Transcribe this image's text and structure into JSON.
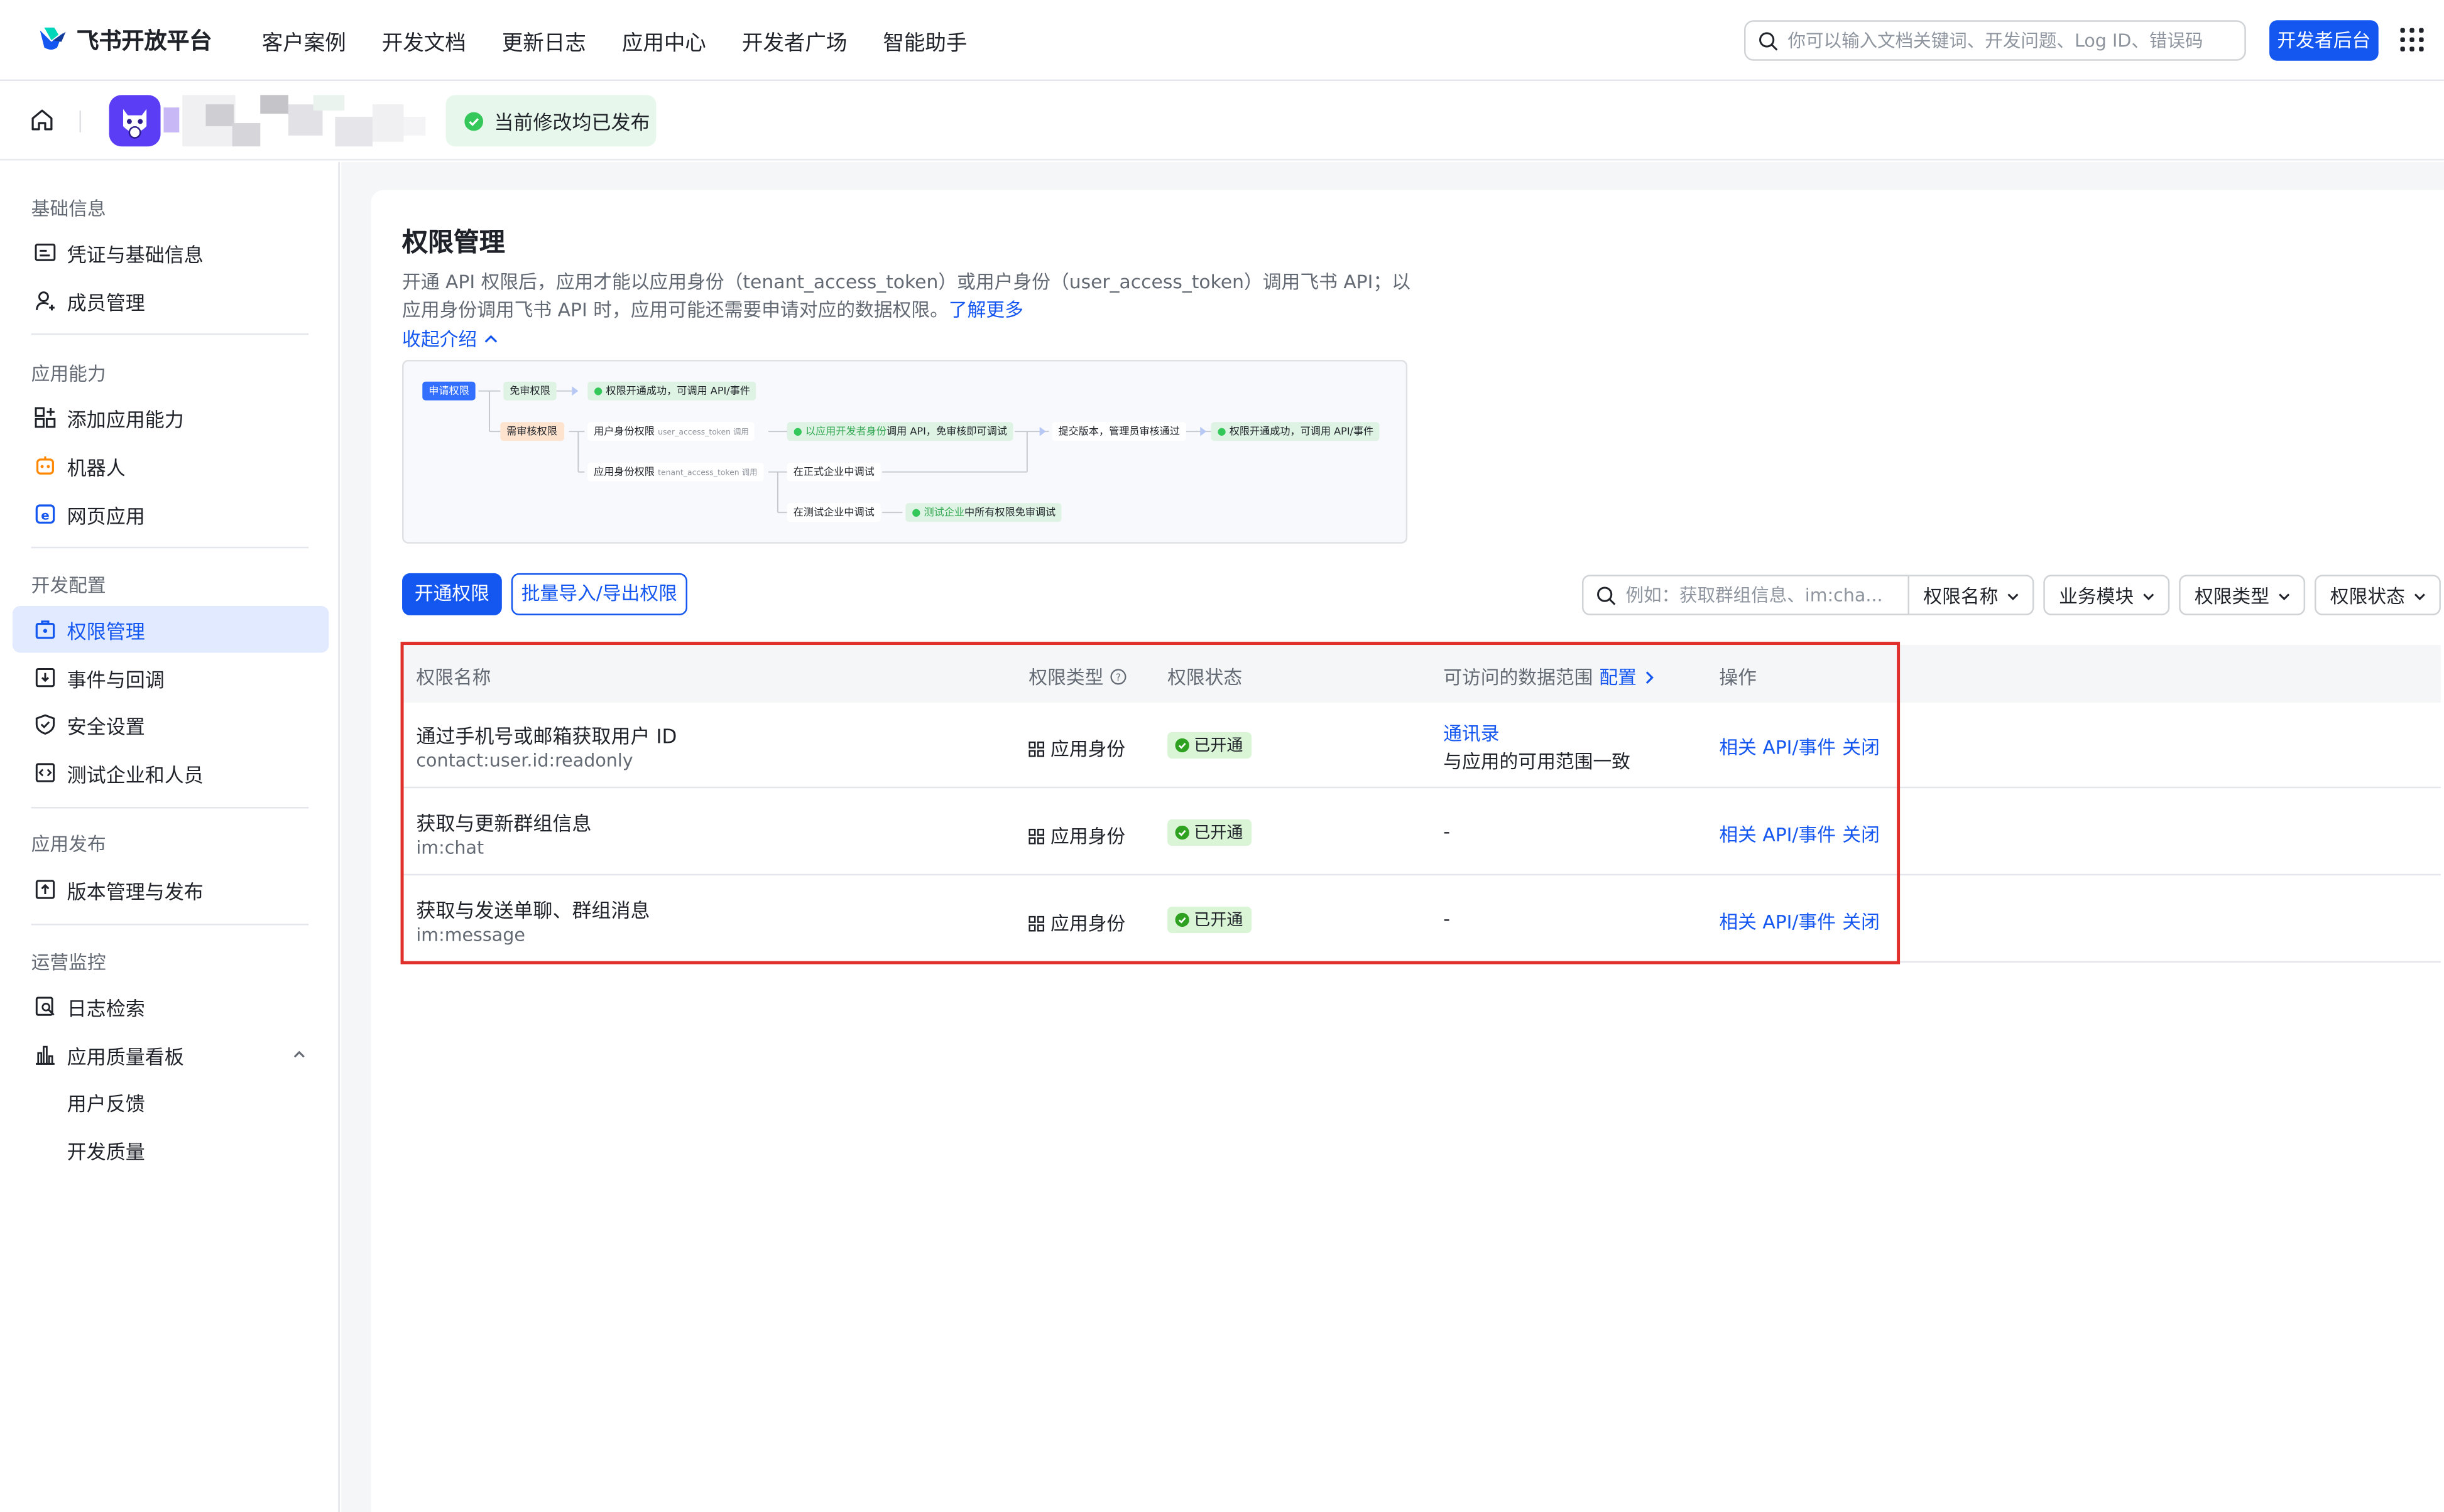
{
  "header": {
    "brand": "飞书开放平台",
    "nav": [
      "客户案例",
      "开发文档",
      "更新日志",
      "应用中心",
      "开发者广场",
      "智能助手"
    ],
    "search_placeholder": "你可以输入文档关键词、开发问题、Log ID、错误码",
    "dev_console_label": "开发者后台"
  },
  "appbar": {
    "publish_status": "当前修改均已发布"
  },
  "sidebar": {
    "sections": [
      {
        "title": "基础信息",
        "items": [
          {
            "label": "凭证与基础信息",
            "icon": "credential-icon"
          },
          {
            "label": "成员管理",
            "icon": "member-icon"
          }
        ]
      },
      {
        "title": "应用能力",
        "items": [
          {
            "label": "添加应用能力",
            "icon": "add-capability-icon"
          },
          {
            "label": "机器人",
            "icon": "robot-icon"
          },
          {
            "label": "网页应用",
            "icon": "web-app-icon"
          }
        ]
      },
      {
        "title": "开发配置",
        "items": [
          {
            "label": "权限管理",
            "icon": "permission-icon",
            "active": true
          },
          {
            "label": "事件与回调",
            "icon": "event-icon"
          },
          {
            "label": "安全设置",
            "icon": "shield-icon"
          },
          {
            "label": "测试企业和人员",
            "icon": "test-icon"
          }
        ]
      },
      {
        "title": "应用发布",
        "items": [
          {
            "label": "版本管理与发布",
            "icon": "version-icon"
          }
        ]
      },
      {
        "title": "运营监控",
        "items": [
          {
            "label": "日志检索",
            "icon": "log-search-icon"
          },
          {
            "label": "应用质量看板",
            "icon": "chart-icon"
          },
          {
            "label": "用户反馈",
            "icon": ""
          },
          {
            "label": "开发质量",
            "icon": ""
          }
        ]
      }
    ]
  },
  "main": {
    "title": "权限管理",
    "description": "开通 API 权限后，应用才能以应用身份（tenant_access_token）或用户身份（user_access_token）调用飞书 API；以应用身份调用飞书 API 时，应用可能还需要申请对应的数据权限。",
    "learn_more": "了解更多",
    "collapse_label": "收起介绍",
    "flow": {
      "apply": "申请权限",
      "no_review": "免审权限",
      "no_review_result": "权限开通成功，可调用 API/事件",
      "need_review": "需审核权限",
      "user_perm": "用户身份权限",
      "user_perm_note": "user_access_token 调用",
      "dev_call_a": "以应用开发者身份",
      "dev_call_b": "调用 API，免审核即可调试",
      "submit": "提交版本，管理员审核通过",
      "final_result": "权限开通成功，可调用 API/事件",
      "app_perm": "应用身份权限",
      "app_perm_note": "tenant_access_token 调用",
      "prod_debug": "在正式企业中调试",
      "test_debug": "在测试企业中调试",
      "test_all_a": "测试企业",
      "test_all_b": "中所有权限免审调试"
    },
    "buttons": {
      "enable": "开通权限",
      "batch": "批量导入/导出权限"
    },
    "filters": {
      "search_placeholder": "例如：获取群组信息、im:cha...",
      "field": "权限名称",
      "module": "业务模块",
      "type": "权限类型",
      "status": "权限状态"
    },
    "table": {
      "headers": {
        "name": "权限名称",
        "type": "权限类型",
        "status": "权限状态",
        "scope": "可访问的数据范围",
        "scope_config": "配置",
        "actions": "操作"
      },
      "rows": [
        {
          "name": "通过手机号或邮箱获取用户 ID",
          "code": "contact:user.id:readonly",
          "type": "应用身份",
          "status": "已开通",
          "scope_link": "通讯录",
          "scope_text": "与应用的可用范围一致",
          "api": "相关 API/事件",
          "close": "关闭"
        },
        {
          "name": "获取与更新群组信息",
          "code": "im:chat",
          "type": "应用身份",
          "status": "已开通",
          "scope_link": "",
          "scope_text": "-",
          "api": "相关 API/事件",
          "close": "关闭"
        },
        {
          "name": "获取与发送单聊、群组消息",
          "code": "im:message",
          "type": "应用身份",
          "status": "已开通",
          "scope_link": "",
          "scope_text": "-",
          "api": "相关 API/事件",
          "close": "关闭"
        }
      ]
    }
  },
  "colors": {
    "brand": "#1456f0",
    "highlight": "#e0302c",
    "success": "#34c759"
  }
}
